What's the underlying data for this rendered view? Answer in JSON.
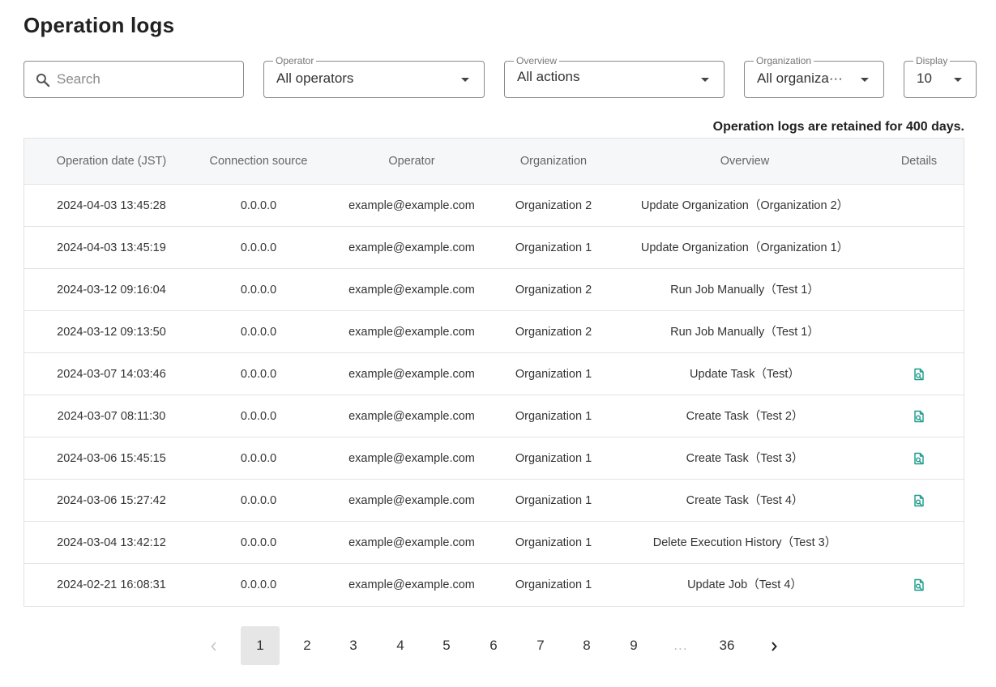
{
  "page": {
    "title": "Operation logs"
  },
  "filters": {
    "search": {
      "placeholder": "Search",
      "value": ""
    },
    "operator": {
      "label": "Operator",
      "value": "All operators"
    },
    "overview": {
      "label": "Overview",
      "value": "All actions"
    },
    "organization": {
      "label": "Organization",
      "value": "All organiza···"
    },
    "display": {
      "label": "Display",
      "value": "10"
    }
  },
  "retention_note": "Operation logs are retained for 400 days.",
  "table": {
    "headers": [
      "Operation date (JST)",
      "Connection source",
      "Operator",
      "Organization",
      "Overview",
      "Details"
    ],
    "rows": [
      {
        "date": "2024-04-03 13:45:28",
        "source": "0.0.0.0",
        "operator": "example@example.com",
        "organization": "Organization 2",
        "overview": "Update Organization（Organization 2）",
        "details": false
      },
      {
        "date": "2024-04-03 13:45:19",
        "source": "0.0.0.0",
        "operator": "example@example.com",
        "organization": "Organization 1",
        "overview": "Update Organization（Organization 1）",
        "details": false
      },
      {
        "date": "2024-03-12 09:16:04",
        "source": "0.0.0.0",
        "operator": "example@example.com",
        "organization": "Organization 2",
        "overview": "Run Job Manually（Test 1）",
        "details": false
      },
      {
        "date": "2024-03-12 09:13:50",
        "source": "0.0.0.0",
        "operator": "example@example.com",
        "organization": "Organization 2",
        "overview": "Run Job Manually（Test 1）",
        "details": false
      },
      {
        "date": "2024-03-07 14:03:46",
        "source": "0.0.0.0",
        "operator": "example@example.com",
        "organization": "Organization 1",
        "overview": "Update Task（Test）",
        "details": true
      },
      {
        "date": "2024-03-07 08:11:30",
        "source": "0.0.0.0",
        "operator": "example@example.com",
        "organization": "Organization 1",
        "overview": "Create Task（Test 2）",
        "details": true
      },
      {
        "date": "2024-03-06 15:45:15",
        "source": "0.0.0.0",
        "operator": "example@example.com",
        "organization": "Organization 1",
        "overview": "Create Task（Test 3）",
        "details": true
      },
      {
        "date": "2024-03-06 15:27:42",
        "source": "0.0.0.0",
        "operator": "example@example.com",
        "organization": "Organization 1",
        "overview": "Create Task（Test 4）",
        "details": true
      },
      {
        "date": "2024-03-04 13:42:12",
        "source": "0.0.0.0",
        "operator": "example@example.com",
        "organization": "Organization 1",
        "overview": "Delete Execution History（Test 3）",
        "details": false
      },
      {
        "date": "2024-02-21 16:08:31",
        "source": "0.0.0.0",
        "operator": "example@example.com",
        "organization": "Organization 1",
        "overview": "Update Job（Test 4）",
        "details": true
      }
    ]
  },
  "pagination": {
    "pages": [
      "1",
      "2",
      "3",
      "4",
      "5",
      "6",
      "7",
      "8",
      "9",
      "...",
      "36"
    ],
    "current": "1",
    "prev_icon": "chevron-left-icon",
    "next_icon": "chevron-right-icon"
  },
  "colors": {
    "detail_icon": "#1a9a8a",
    "active_page_bg": "#e6e6e6",
    "header_bg": "#f6f7f8"
  }
}
